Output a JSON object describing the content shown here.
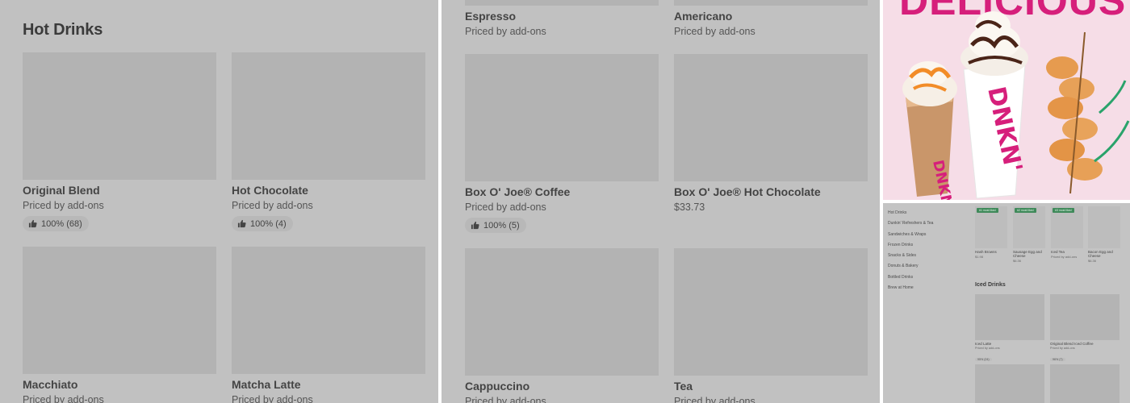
{
  "panel1": {
    "section_title": "Hot Drinks",
    "items": [
      {
        "name": "Original Blend",
        "price": "Priced by add-ons",
        "rating": "100% (68)"
      },
      {
        "name": "Hot Chocolate",
        "price": "Priced by add-ons",
        "rating": "100% (4)"
      },
      {
        "name": "Macchiato",
        "price": "Priced by add-ons",
        "rating": ""
      },
      {
        "name": "Matcha Latte",
        "price": "Priced by add-ons",
        "rating": ""
      }
    ]
  },
  "panel2": {
    "items": [
      {
        "name": "Espresso",
        "price": "Priced by add-ons",
        "rating": ""
      },
      {
        "name": "Americano",
        "price": "Priced by add-ons",
        "rating": ""
      },
      {
        "name": "Box O' Joe® Coffee",
        "price": "Priced by add-ons",
        "rating": "100% (5)"
      },
      {
        "name": "Box O' Joe® Hot Chocolate",
        "price": "$33.73",
        "rating": ""
      },
      {
        "name": "Cappuccino",
        "price": "Priced by add-ons",
        "rating": ""
      },
      {
        "name": "Tea",
        "price": "Priced by add-ons",
        "rating": ""
      }
    ]
  },
  "promo": {
    "headline": "DELICIOUS",
    "cup_brand": "DNKN'",
    "colors": {
      "brand_pink": "#d61f7b",
      "brand_orange": "#f28c28"
    }
  },
  "mini": {
    "sidebar": [
      "Hot Drinks",
      "Dunkin' Refreshers & Tea",
      "Sandwiches & Wraps",
      "Frozen Drinks",
      "Snacks & Sides",
      "Donuts & Bakery",
      "Bottled Drinks",
      "Brew at Home"
    ],
    "featured": [
      {
        "badge": "#1 most liked",
        "name": "Hash Browns",
        "price": "$1.98"
      },
      {
        "badge": "#2 most liked",
        "name": "Sausage Egg and Cheese",
        "price": "$6.36"
      },
      {
        "badge": "#3 most liked",
        "name": "Iced Tea",
        "price": "Priced by add-ons"
      },
      {
        "badge": "",
        "name": "Bacon Egg and Cheese",
        "price": "$6.36"
      }
    ],
    "section_title": "Iced Drinks",
    "cards": [
      {
        "name": "Iced Latte",
        "price": "Priced by add-ons",
        "rating": "95% (24)"
      },
      {
        "name": "Original Blend Iced Coffee",
        "price": "Priced by add-ons",
        "rating": "96% (7)"
      }
    ]
  }
}
